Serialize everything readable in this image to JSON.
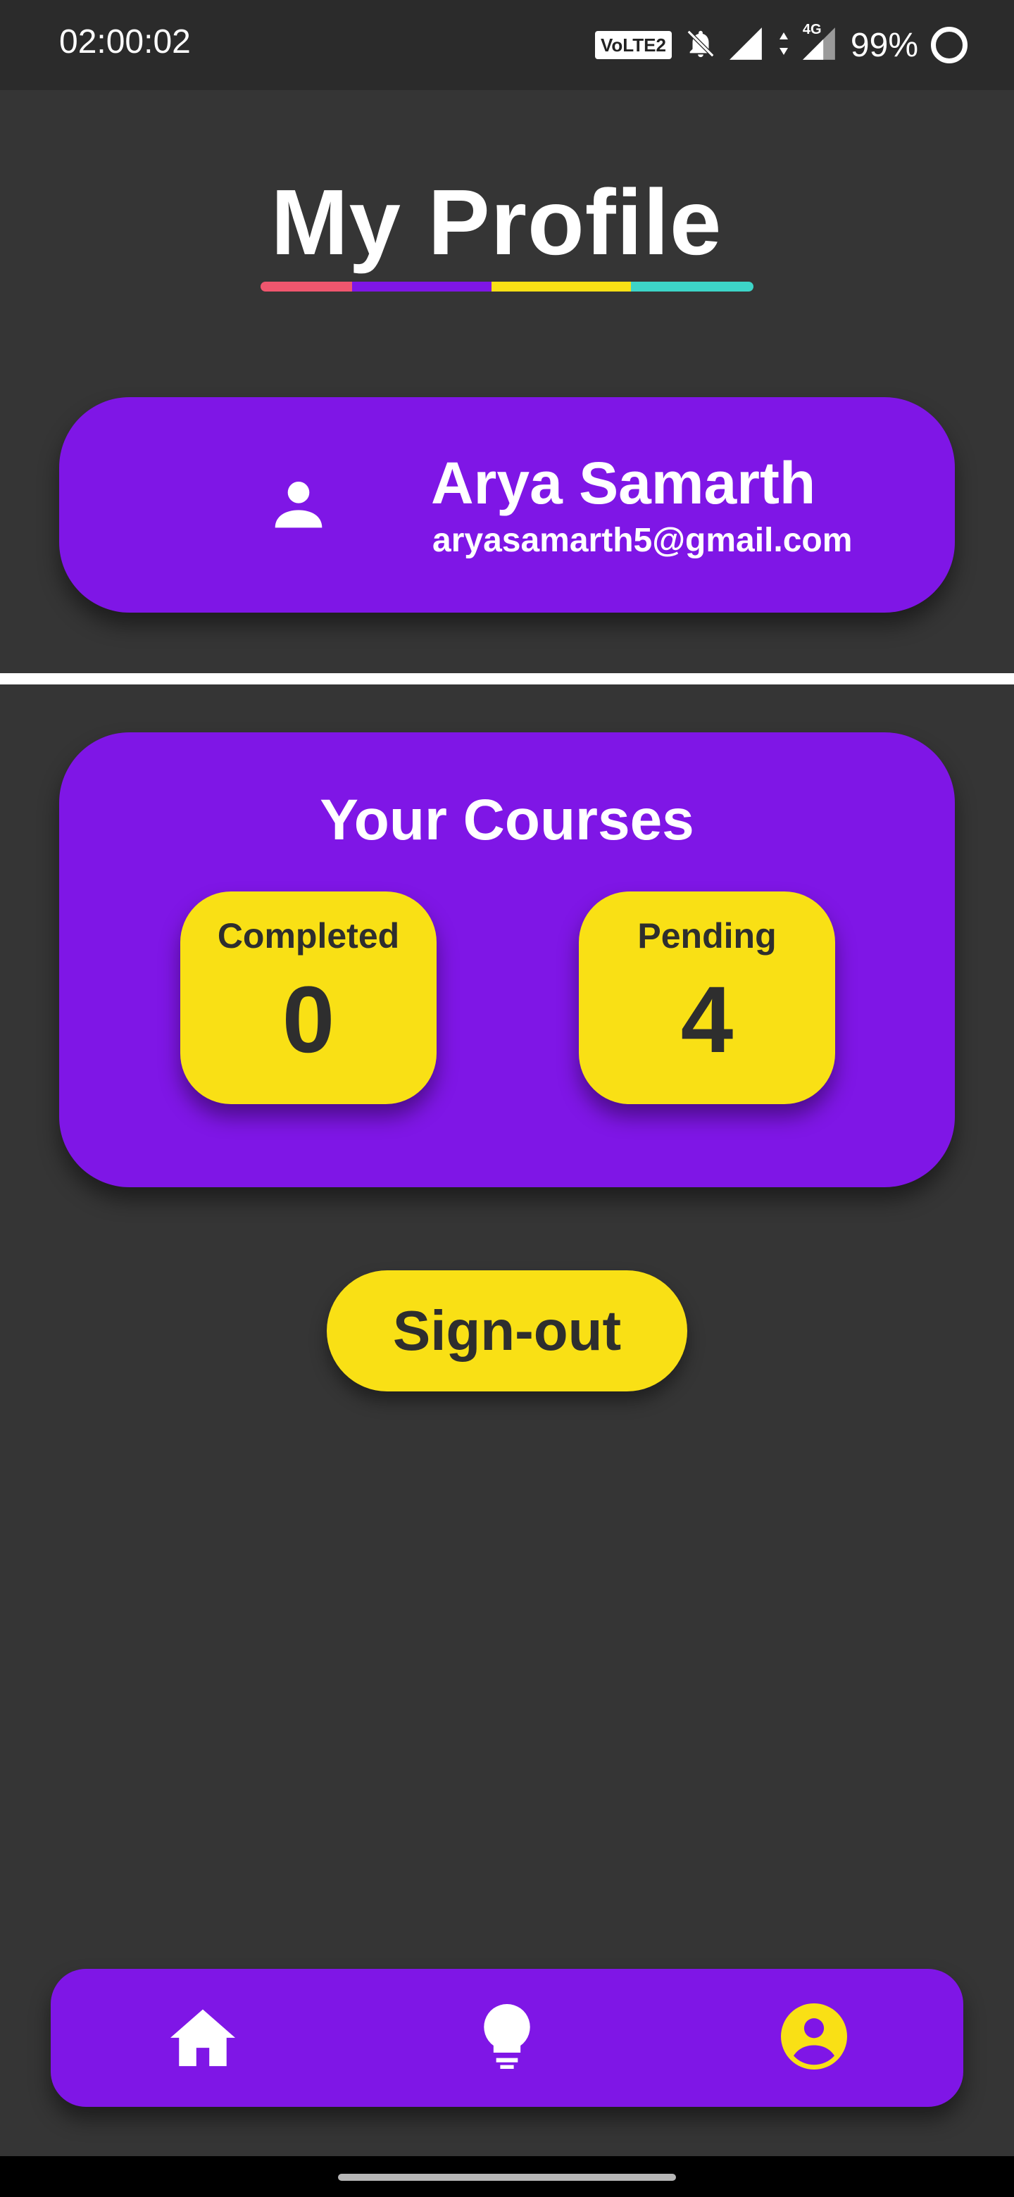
{
  "status_bar": {
    "time": "02:00:02",
    "volte": "VoLTE2",
    "network": "4G",
    "battery": "99%"
  },
  "page": {
    "title": "My Profile",
    "underline_colors": [
      "#f0566e",
      "#7f16e6",
      "#f9e015",
      "#3dd5c8"
    ]
  },
  "profile": {
    "name": "Arya Samarth",
    "email": "aryasamarth5@gmail.com",
    "icon": "person-icon"
  },
  "courses": {
    "title": "Your Courses",
    "completed_label": "Completed",
    "completed_value": "0",
    "pending_label": "Pending",
    "pending_value": "4"
  },
  "actions": {
    "signout_label": "Sign-out"
  },
  "nav": {
    "items": [
      {
        "icon": "home-icon",
        "active": false
      },
      {
        "icon": "lightbulb-icon",
        "active": false
      },
      {
        "icon": "account-circle-icon",
        "active": true
      }
    ]
  },
  "colors": {
    "background": "#353535",
    "card": "#7f16e6",
    "accent": "#f9e015",
    "text_dark": "#2e2e2e"
  }
}
